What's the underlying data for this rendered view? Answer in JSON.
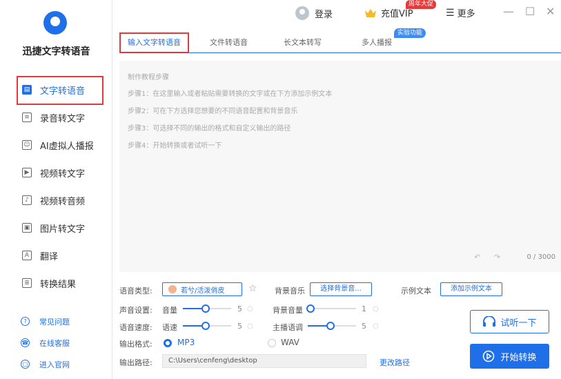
{
  "app": {
    "name": "迅捷文字转语音"
  },
  "topbar": {
    "login": "登录",
    "vip": "充值VIP",
    "promo_badge": "周年大促",
    "more": "更多",
    "minimize": "—",
    "maximize": "☐",
    "close": "✕"
  },
  "sidebar": {
    "items": [
      {
        "label": "文字转语音",
        "icon": "text-to-speech-icon",
        "active": true
      },
      {
        "label": "录音转文字",
        "icon": "recording-icon"
      },
      {
        "label": "AI虚拟人播报",
        "icon": "ai-avatar-icon"
      },
      {
        "label": "视频转文字",
        "icon": "video-text-icon"
      },
      {
        "label": "视频转音频",
        "icon": "video-audio-icon"
      },
      {
        "label": "图片转文字",
        "icon": "image-text-icon"
      },
      {
        "label": "翻译",
        "icon": "translate-icon"
      },
      {
        "label": "转换结果",
        "icon": "result-icon"
      }
    ],
    "help": [
      {
        "label": "常见问题",
        "icon": "faq-icon"
      },
      {
        "label": "在线客服",
        "icon": "support-icon"
      },
      {
        "label": "进入官网",
        "icon": "website-icon"
      }
    ]
  },
  "tabs": [
    {
      "label": "输入文字转语音",
      "active": true
    },
    {
      "label": "文件转语音"
    },
    {
      "label": "长文本转写"
    },
    {
      "label": "多人播报"
    }
  ],
  "lab_badge": "实验功能",
  "editor": {
    "guide_title": "制作教程步骤",
    "steps": [
      "步骤1：在这里输入或者粘贴需要转换的文字或在下方添加示例文本",
      "步骤2：可在下方选择您想要的不同语音配置和背景音乐",
      "步骤3：可选择不同的输出的格式和自定义输出的路径",
      "步骤4：开始转换或者试听一下"
    ],
    "undo_redo": "↶ ↷",
    "counter": "0 / 3000"
  },
  "settings": {
    "voice_type_label": "语音类型:",
    "voice_value": "若兮/活泼俏皮",
    "bg_music_label": "背景音乐",
    "bg_music_button": "选择背景音...",
    "example_label": "示例文本",
    "example_button": "添加示例文本",
    "sound_label": "声音设置:",
    "volume_label": "音量",
    "volume_value": "5",
    "bg_volume_label": "背景音量",
    "bg_volume_value": "1",
    "speed_label": "语音速度:",
    "speed_sub": "语速",
    "speed_value": "5",
    "pitch_label": "主播语调",
    "pitch_value": "5",
    "format_label": "输出格式:",
    "format_mp3": "MP3",
    "format_wav": "WAV",
    "path_label": "输出路径:",
    "path_value": "C:\\Users\\cenfeng\\desktop",
    "change_path": "更改路径",
    "reset_glyph": "○"
  },
  "actions": {
    "listen": "试听一下",
    "convert": "开始转换"
  },
  "colors": {
    "accent": "#1f6fe8",
    "highlight": "#e23a3a"
  }
}
